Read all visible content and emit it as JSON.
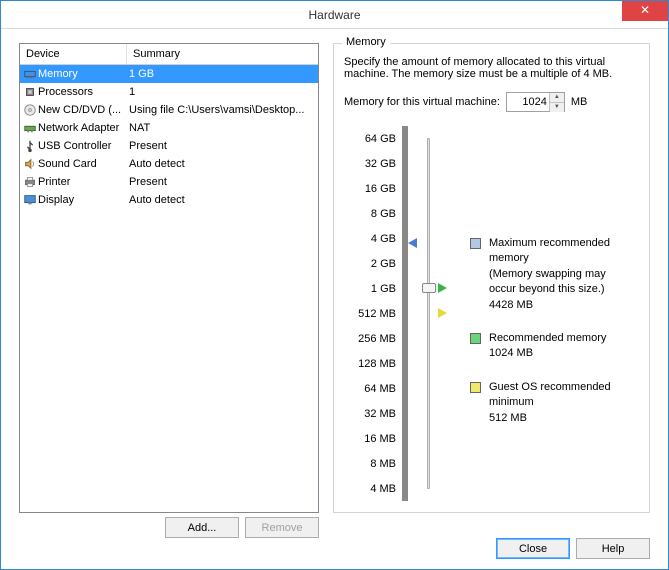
{
  "window": {
    "title": "Hardware"
  },
  "device_list": {
    "headers": {
      "device": "Device",
      "summary": "Summary"
    },
    "items": [
      {
        "icon": "memory-icon",
        "name": "Memory",
        "summary": "1 GB",
        "selected": true
      },
      {
        "icon": "processor-icon",
        "name": "Processors",
        "summary": "1",
        "selected": false
      },
      {
        "icon": "cd-icon",
        "name": "New CD/DVD (...",
        "summary": "Using file C:\\Users\\vamsi\\Desktop...",
        "selected": false
      },
      {
        "icon": "network-icon",
        "name": "Network Adapter",
        "summary": "NAT",
        "selected": false
      },
      {
        "icon": "usb-icon",
        "name": "USB Controller",
        "summary": "Present",
        "selected": false
      },
      {
        "icon": "sound-icon",
        "name": "Sound Card",
        "summary": "Auto detect",
        "selected": false
      },
      {
        "icon": "printer-icon",
        "name": "Printer",
        "summary": "Present",
        "selected": false
      },
      {
        "icon": "display-icon",
        "name": "Display",
        "summary": "Auto detect",
        "selected": false
      }
    ]
  },
  "buttons": {
    "add": "Add...",
    "remove": "Remove",
    "close": "Close",
    "help": "Help"
  },
  "memory_panel": {
    "group_title": "Memory",
    "description": "Specify the amount of memory allocated to this virtual machine. The memory size must be a multiple of 4 MB.",
    "input_label": "Memory for this virtual machine:",
    "value": "1024",
    "unit": "MB",
    "ticks": [
      "64 GB",
      "32 GB",
      "16 GB",
      "8 GB",
      "4 GB",
      "2 GB",
      "1 GB",
      "512 MB",
      "256 MB",
      "128 MB",
      "64 MB",
      "32 MB",
      "16 MB",
      "8 MB",
      "4 MB"
    ],
    "legend": {
      "max": {
        "title": "Maximum recommended memory",
        "note": "(Memory swapping may occur beyond this size.)",
        "value": "4428 MB"
      },
      "rec": {
        "title": "Recommended memory",
        "value": "1024 MB"
      },
      "min": {
        "title": "Guest OS recommended minimum",
        "value": "512 MB"
      }
    },
    "slider": {
      "thumb_tick_index": 6,
      "blue_tick_index": 4.2,
      "green_tick_index": 6,
      "yellow_tick_index": 7
    }
  }
}
